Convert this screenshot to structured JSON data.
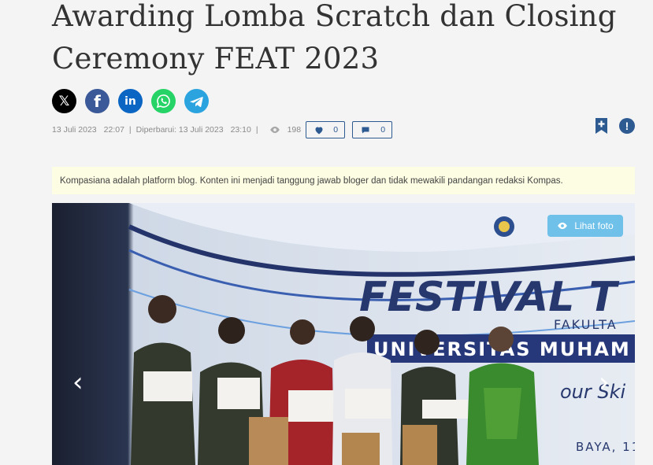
{
  "article": {
    "title": "Awarding Lomba Scratch dan Closing Ceremony FEAT 2023",
    "published_date": "13 Juli 2023",
    "published_time": "22:07",
    "updated_label": "Diperbarui: 13 Juli 2023",
    "updated_time": "23:10",
    "views": "198",
    "likes": "0",
    "comments": "0"
  },
  "share": {
    "icons": [
      "x-icon",
      "facebook-icon",
      "linkedin-icon",
      "whatsapp-icon",
      "telegram-icon"
    ],
    "x_glyph": "𝕏",
    "facebook_glyph": "f",
    "linkedin_glyph": "in"
  },
  "disclaimer": "Kompasiana adalah platform blog. Konten ini menjadi tanggung jawab bloger dan tidak mewakili pandangan redaksi Kompas.",
  "photo": {
    "view_button_label": "Lihat foto",
    "banner_title": "FESTIVAL T",
    "banner_faculty": "FAKULTA",
    "banner_university": "UNIVERSITAS MUHAM",
    "banner_tagline": "our Ski",
    "banner_city": "BAYA, 11",
    "prev_glyph": "‹",
    "next_glyph": "›"
  },
  "colors": {
    "brand_blue": "#2e5a92",
    "disclaimer_bg": "#fdfde3",
    "view_button": "#6fc1ea"
  }
}
